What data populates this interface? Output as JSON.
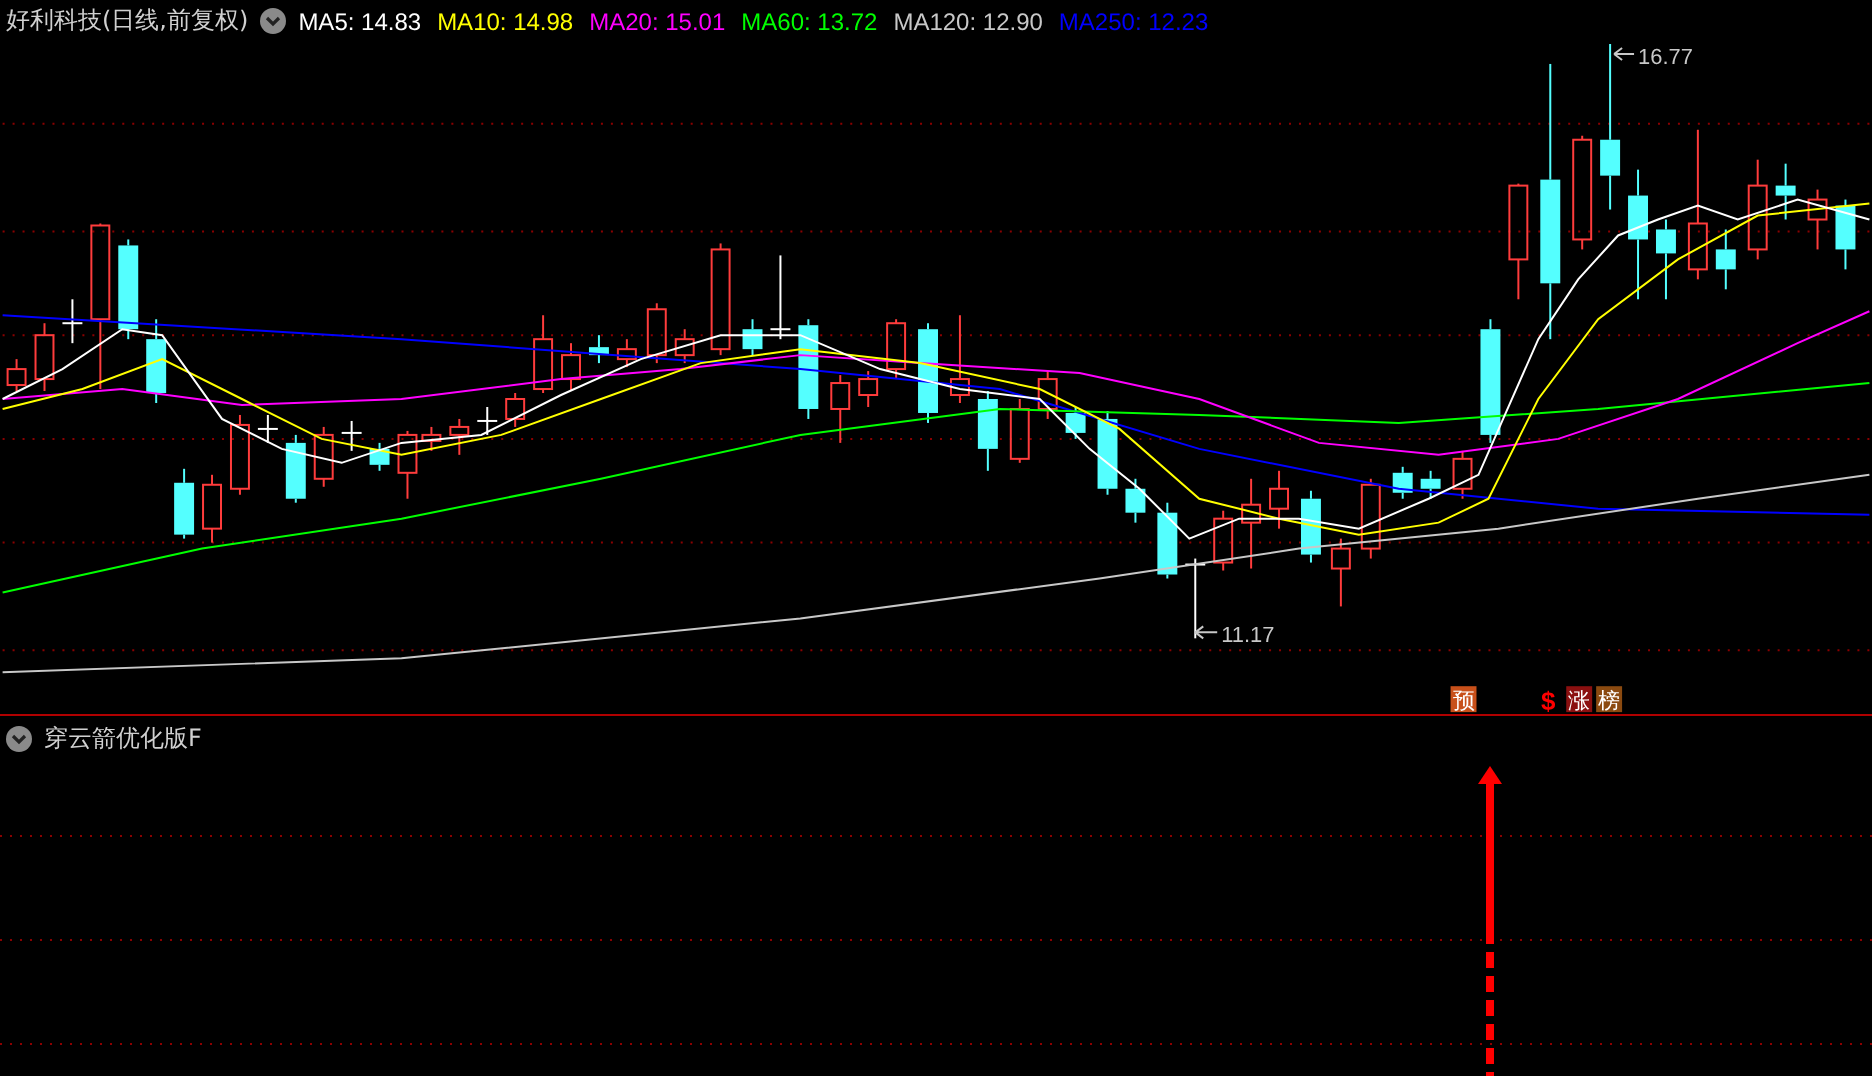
{
  "main_panel": {
    "title": "好利科技(日线,前复权)",
    "indicators": [
      {
        "label": "MA5:",
        "value": "14.83",
        "color": "#ffffff"
      },
      {
        "label": "MA10:",
        "value": "14.98",
        "color": "#ffff00"
      },
      {
        "label": "MA20:",
        "value": "15.01",
        "color": "#ff00ff"
      },
      {
        "label": "MA60:",
        "value": "13.72",
        "color": "#00ff00"
      },
      {
        "label": "MA120:",
        "value": "12.90",
        "color": "#c8c8c8"
      },
      {
        "label": "MA250:",
        "value": "12.23",
        "color": "#0000ff"
      }
    ],
    "high_label": "16.77",
    "low_label": "11.17",
    "markers": [
      {
        "text": "预",
        "kind": "badge",
        "color": "#c8501a"
      },
      {
        "text": "$",
        "kind": "glyph",
        "color": "#ff0000"
      },
      {
        "text": "涨",
        "kind": "badge",
        "color": "#8b1010"
      },
      {
        "text": "榜",
        "kind": "badge",
        "color": "#8b4a10"
      }
    ]
  },
  "indicator_panel": {
    "title": "穿云箭优化版F"
  }
}
